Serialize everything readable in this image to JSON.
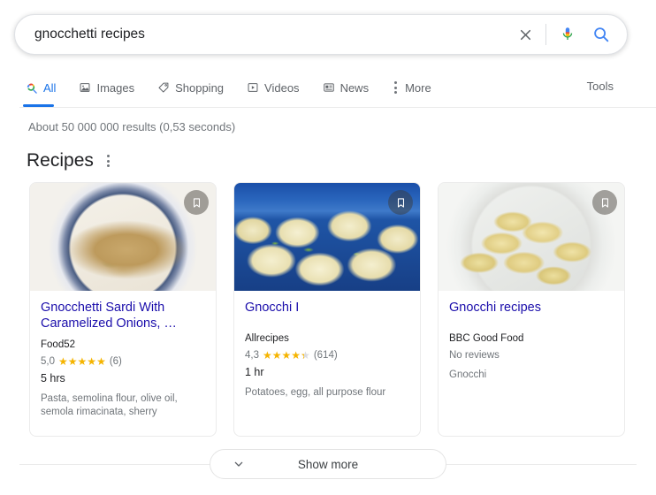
{
  "search": {
    "query": "gnocchetti recipes",
    "placeholder": "Search",
    "clear_icon": "close-x-icon",
    "mic_icon": "microphone-icon",
    "search_icon": "magnifier-icon"
  },
  "nav": {
    "tabs": [
      {
        "label": "All",
        "icon": "google-search-icon",
        "active": true
      },
      {
        "label": "Images",
        "icon": "image-icon",
        "active": false
      },
      {
        "label": "Shopping",
        "icon": "price-tag-icon",
        "active": false
      },
      {
        "label": "Videos",
        "icon": "video-play-icon",
        "active": false
      },
      {
        "label": "News",
        "icon": "newspaper-icon",
        "active": false
      },
      {
        "label": "More",
        "icon": "kebab-menu-icon",
        "active": false
      }
    ],
    "tools_label": "Tools"
  },
  "result_stats": "About 50 000 000 results (0,53 seconds)",
  "section": {
    "title": "Recipes",
    "menu_icon": "kebab-menu-icon"
  },
  "cards": [
    {
      "title": "Gnocchetti Sardi With Caramelized Onions, …",
      "source": "Food52",
      "rating_value": "5,0",
      "rating_stars": 5,
      "review_count": "(6)",
      "has_reviews": true,
      "time": "5 hrs",
      "ingredients": "Pasta, semolina flour, olive oil, semola rimacinata, sherry",
      "bookmark_icon": "bookmark-icon",
      "photo": "creamy-gnocchi-in-striped-bowl"
    },
    {
      "title": "Gnocchi I",
      "source": "Allrecipes",
      "rating_value": "4,3",
      "rating_stars": 4.3,
      "review_count": "(614)",
      "has_reviews": true,
      "time": "1 hr",
      "ingredients": "Potatoes, egg, all purpose flour",
      "bookmark_icon": "bookmark-icon",
      "photo": "gnocchi-with-herbs-on-blue-plate"
    },
    {
      "title": "Gnocchi recipes",
      "source": "BBC Good Food",
      "rating_value": "",
      "rating_stars": 0,
      "review_count": "",
      "has_reviews": false,
      "no_reviews_label": "No reviews",
      "time": "",
      "ingredients": "Gnocchi",
      "bookmark_icon": "bookmark-icon",
      "photo": "peppered-gnocchi-in-white-bowl"
    }
  ],
  "show_more": {
    "label": "Show more",
    "icon": "chevron-down-icon"
  },
  "colors": {
    "link_blue": "#1a0dab",
    "accent_blue": "#1a73e8",
    "star_gold": "#f5b400",
    "text_grey": "#70757a",
    "text_dark": "#202124"
  }
}
